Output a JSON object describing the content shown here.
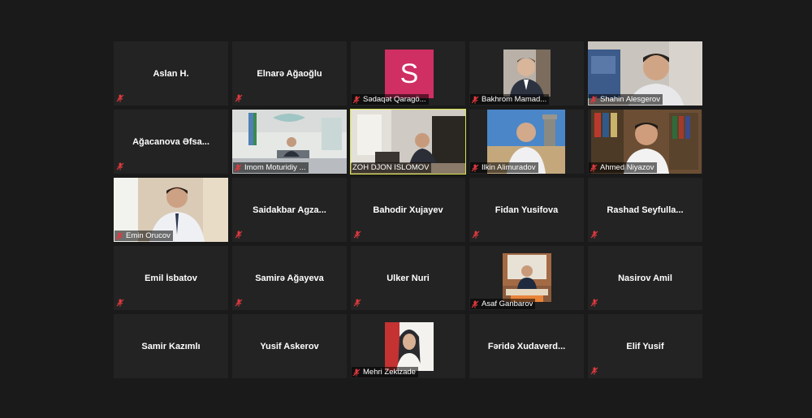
{
  "app": "Zoom gallery view",
  "participants": [
    {
      "name": "Aslan H.",
      "type": "name"
    },
    {
      "name": "Elnarə Ağaoğlu",
      "type": "name"
    },
    {
      "name": "Sədaqət Qaragö...",
      "type": "avatar",
      "avatar_letter": "S",
      "avatar_color": "#cf2f63"
    },
    {
      "name": "Bakhrom Mamad...",
      "type": "video"
    },
    {
      "name": "Shahin Alesgerov",
      "type": "video"
    },
    {
      "name": "Ağacanova  Əfsa...",
      "type": "name"
    },
    {
      "name": "Imom Moturidiy ...",
      "type": "video"
    },
    {
      "name": "ZOH DJON ISLOMOV",
      "type": "video",
      "active_speaker": true,
      "highlight_color": "#d6e34a"
    },
    {
      "name": "Ilkin Alimuradov",
      "type": "video"
    },
    {
      "name": "Ahmed Niyazov",
      "type": "video"
    },
    {
      "name": "Emin Orucov",
      "type": "video"
    },
    {
      "name": "Saidakbar  Agza...",
      "type": "name"
    },
    {
      "name": "Bahodir Xujayev",
      "type": "name"
    },
    {
      "name": "Fidan Yusifova",
      "type": "name"
    },
    {
      "name": "Rashad  Seyfulla...",
      "type": "name"
    },
    {
      "name": "Emil İsbatov",
      "type": "name"
    },
    {
      "name": "Samirə Ağayeva",
      "type": "name"
    },
    {
      "name": "Ulker Nuri",
      "type": "name"
    },
    {
      "name": "Asaf Ganbarov",
      "type": "video"
    },
    {
      "name": "Nasirov Amil",
      "type": "name"
    },
    {
      "name": "Samir Kazımlı",
      "type": "name"
    },
    {
      "name": "Yusif Askerov",
      "type": "name"
    },
    {
      "name": "Mehri Zekizade",
      "type": "video"
    },
    {
      "name": "Fəridə  Xudaverd...",
      "type": "name"
    },
    {
      "name": "Elif Yusif",
      "type": "name"
    }
  ],
  "icons": {
    "muted": "microphone-muted-icon",
    "muted_color": "#e0393e"
  }
}
